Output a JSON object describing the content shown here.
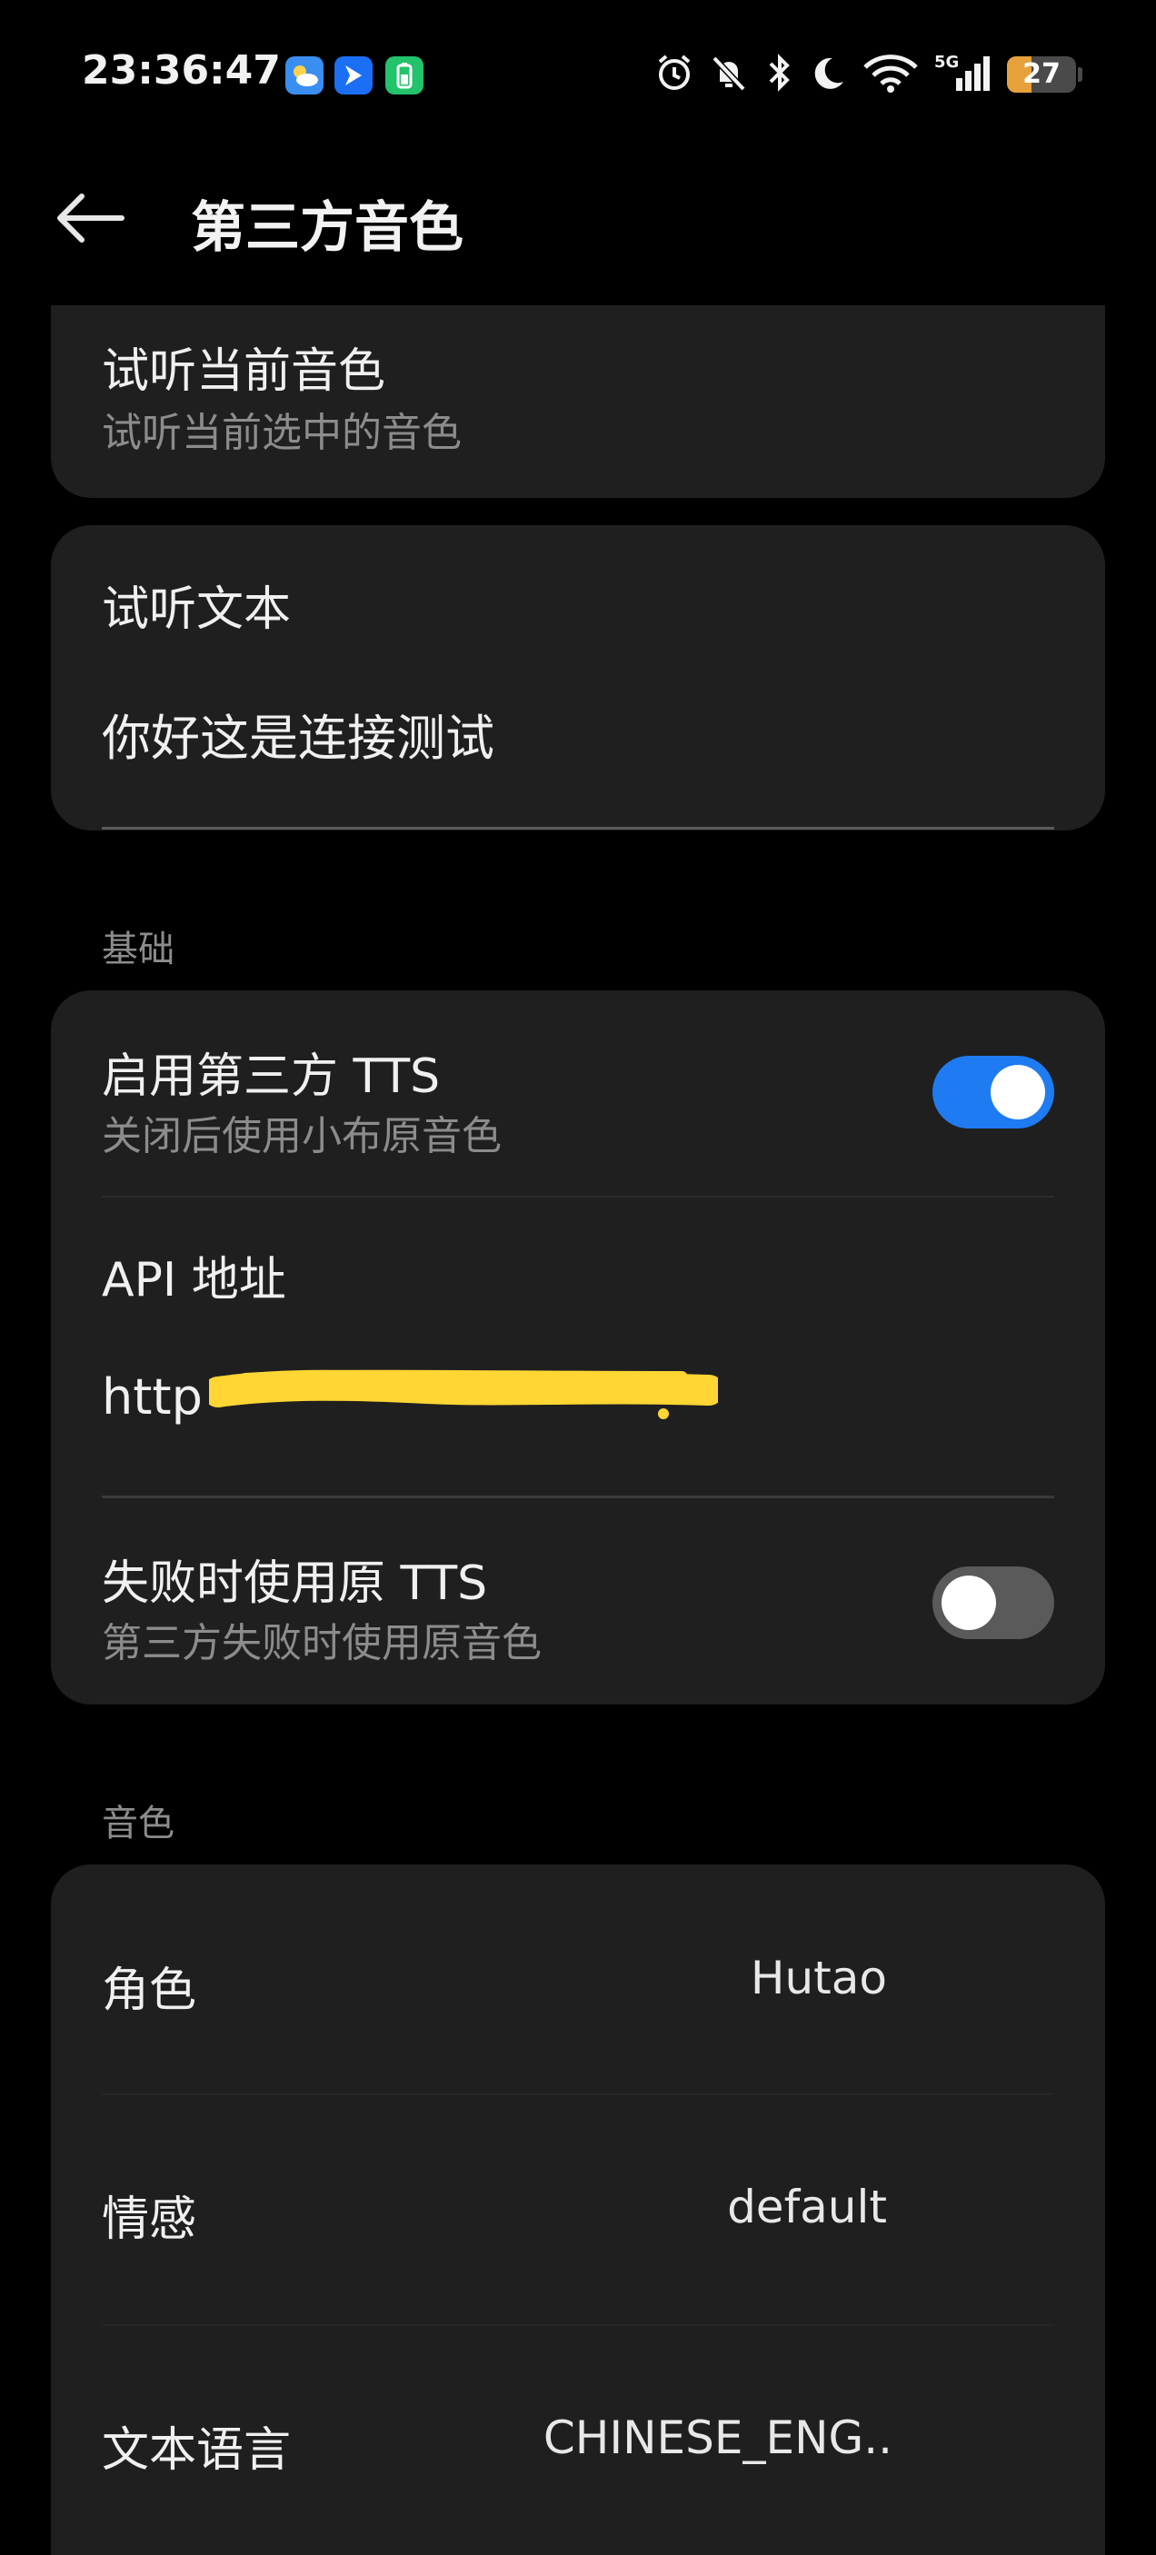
{
  "status_bar": {
    "time": "23:36:47",
    "battery": "27",
    "icons": [
      "weather-app-icon",
      "messenger-app-icon",
      "battery-app-icon",
      "alarm-icon",
      "mute-icon",
      "bluetooth-icon",
      "moon-icon",
      "wifi-icon",
      "signal-5g-icon"
    ]
  },
  "header": {
    "back_icon": "arrow-left-icon",
    "title": "第三方音色"
  },
  "preview_card": {
    "title": "试听当前音色",
    "subtitle": "试听当前选中的音色"
  },
  "preview_text_card": {
    "label": "试听文本",
    "value": "你好这是连接测试"
  },
  "basic": {
    "section_label": "基础",
    "enable_tts": {
      "title": "启用第三方 TTS",
      "subtitle": "关闭后使用小布原音色",
      "on": true
    },
    "api": {
      "label": "API 地址",
      "value": "http"
    },
    "fallback": {
      "title": "失败时使用原 TTS",
      "subtitle": "第三方失败时使用原音色",
      "on": false
    }
  },
  "voice": {
    "section_label": "音色",
    "rows": [
      {
        "label": "角色",
        "value": "Hutao"
      },
      {
        "label": "情感",
        "value": "default"
      },
      {
        "label": "文本语言",
        "value": "CHINESE_ENG.."
      }
    ]
  },
  "colors": {
    "accent": "#1f7bf2",
    "card": "#1f1f1f",
    "background": "#000000",
    "redaction": "#ffd633"
  }
}
